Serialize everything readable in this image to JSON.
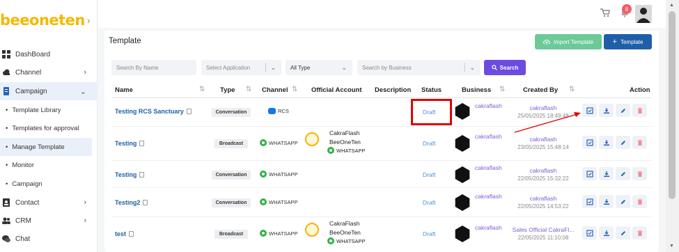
{
  "app": {
    "logo_text": "beeoneten",
    "logo_chevron": "›"
  },
  "sidebar": {
    "items": [
      {
        "label": "DashBoard",
        "icon": "grid-icon"
      },
      {
        "label": "Channel",
        "icon": "cloud-icon"
      },
      {
        "label": "Campaign",
        "icon": "document-icon"
      },
      {
        "label": "Contact",
        "icon": "contact-icon"
      },
      {
        "label": "CRM",
        "icon": "users-icon"
      },
      {
        "label": "Chat",
        "icon": "chat-icon"
      }
    ],
    "sub_items": [
      "Template Library",
      "Templates for approval",
      "Manage Template",
      "Monitor",
      "Campaign"
    ]
  },
  "header": {
    "notification_count": "8"
  },
  "page": {
    "title": "Template",
    "import_label": "Import Template",
    "add_label": "Template"
  },
  "filters": {
    "search_name_placeholder": "Search By Name",
    "application_placeholder": "Select Application",
    "type_value": "All Type",
    "business_placeholder": "Search by Business",
    "search_button": "Search"
  },
  "table": {
    "headers": [
      "Name",
      "Type",
      "Channel",
      "Official Account",
      "Description",
      "Status",
      "Business",
      "Created By",
      "Action"
    ],
    "rows": [
      {
        "name": "Testing RCS Sanctuary",
        "type": "Conversation",
        "channel": "RCS",
        "official_account": [],
        "status": "Draft",
        "business": "cakraflash",
        "created_by": "cakraflash",
        "created_at": "25/05/2025 18:49:48"
      },
      {
        "name": "Testing",
        "type": "Broadcast",
        "channel": "WHATSAPP",
        "official_account": [
          "CakraFlash",
          "BeeOneTen",
          "WHATSAPP"
        ],
        "status": "Draft",
        "business": "cakraflash",
        "created_by": "cakraflash",
        "created_at": "23/05/2025 15:48:14"
      },
      {
        "name": "Testing",
        "type": "Conversation",
        "channel": "WHATSAPP",
        "official_account": [],
        "status": "Draft",
        "business": "cakraflash",
        "created_by": "cakraflash",
        "created_at": "22/05/2025 15:32:22"
      },
      {
        "name": "Testing2",
        "type": "Conversation",
        "channel": "WHATSAPP",
        "official_account": [],
        "status": "Draft",
        "business": "cakraflash",
        "created_by": "cakraflash",
        "created_at": "22/05/2025 14:53:22"
      },
      {
        "name": "test",
        "type": "Broadcast",
        "channel": "WHATSAPP",
        "official_account": [
          "CakraFlash",
          "BeeOneTen",
          "WHATSAPP"
        ],
        "status": "Draft",
        "business": "cakraflash",
        "created_by": "Sales Official CakraFl...",
        "created_at": "22/05/2025 11:10:08"
      }
    ]
  },
  "colors": {
    "brand": "#f5b800",
    "primary": "#1f5fa8",
    "import": "#6cc998",
    "search": "#6c4be0",
    "link": "#1e5fa8",
    "business": "#7d5bd6",
    "highlight": "#e00000"
  }
}
